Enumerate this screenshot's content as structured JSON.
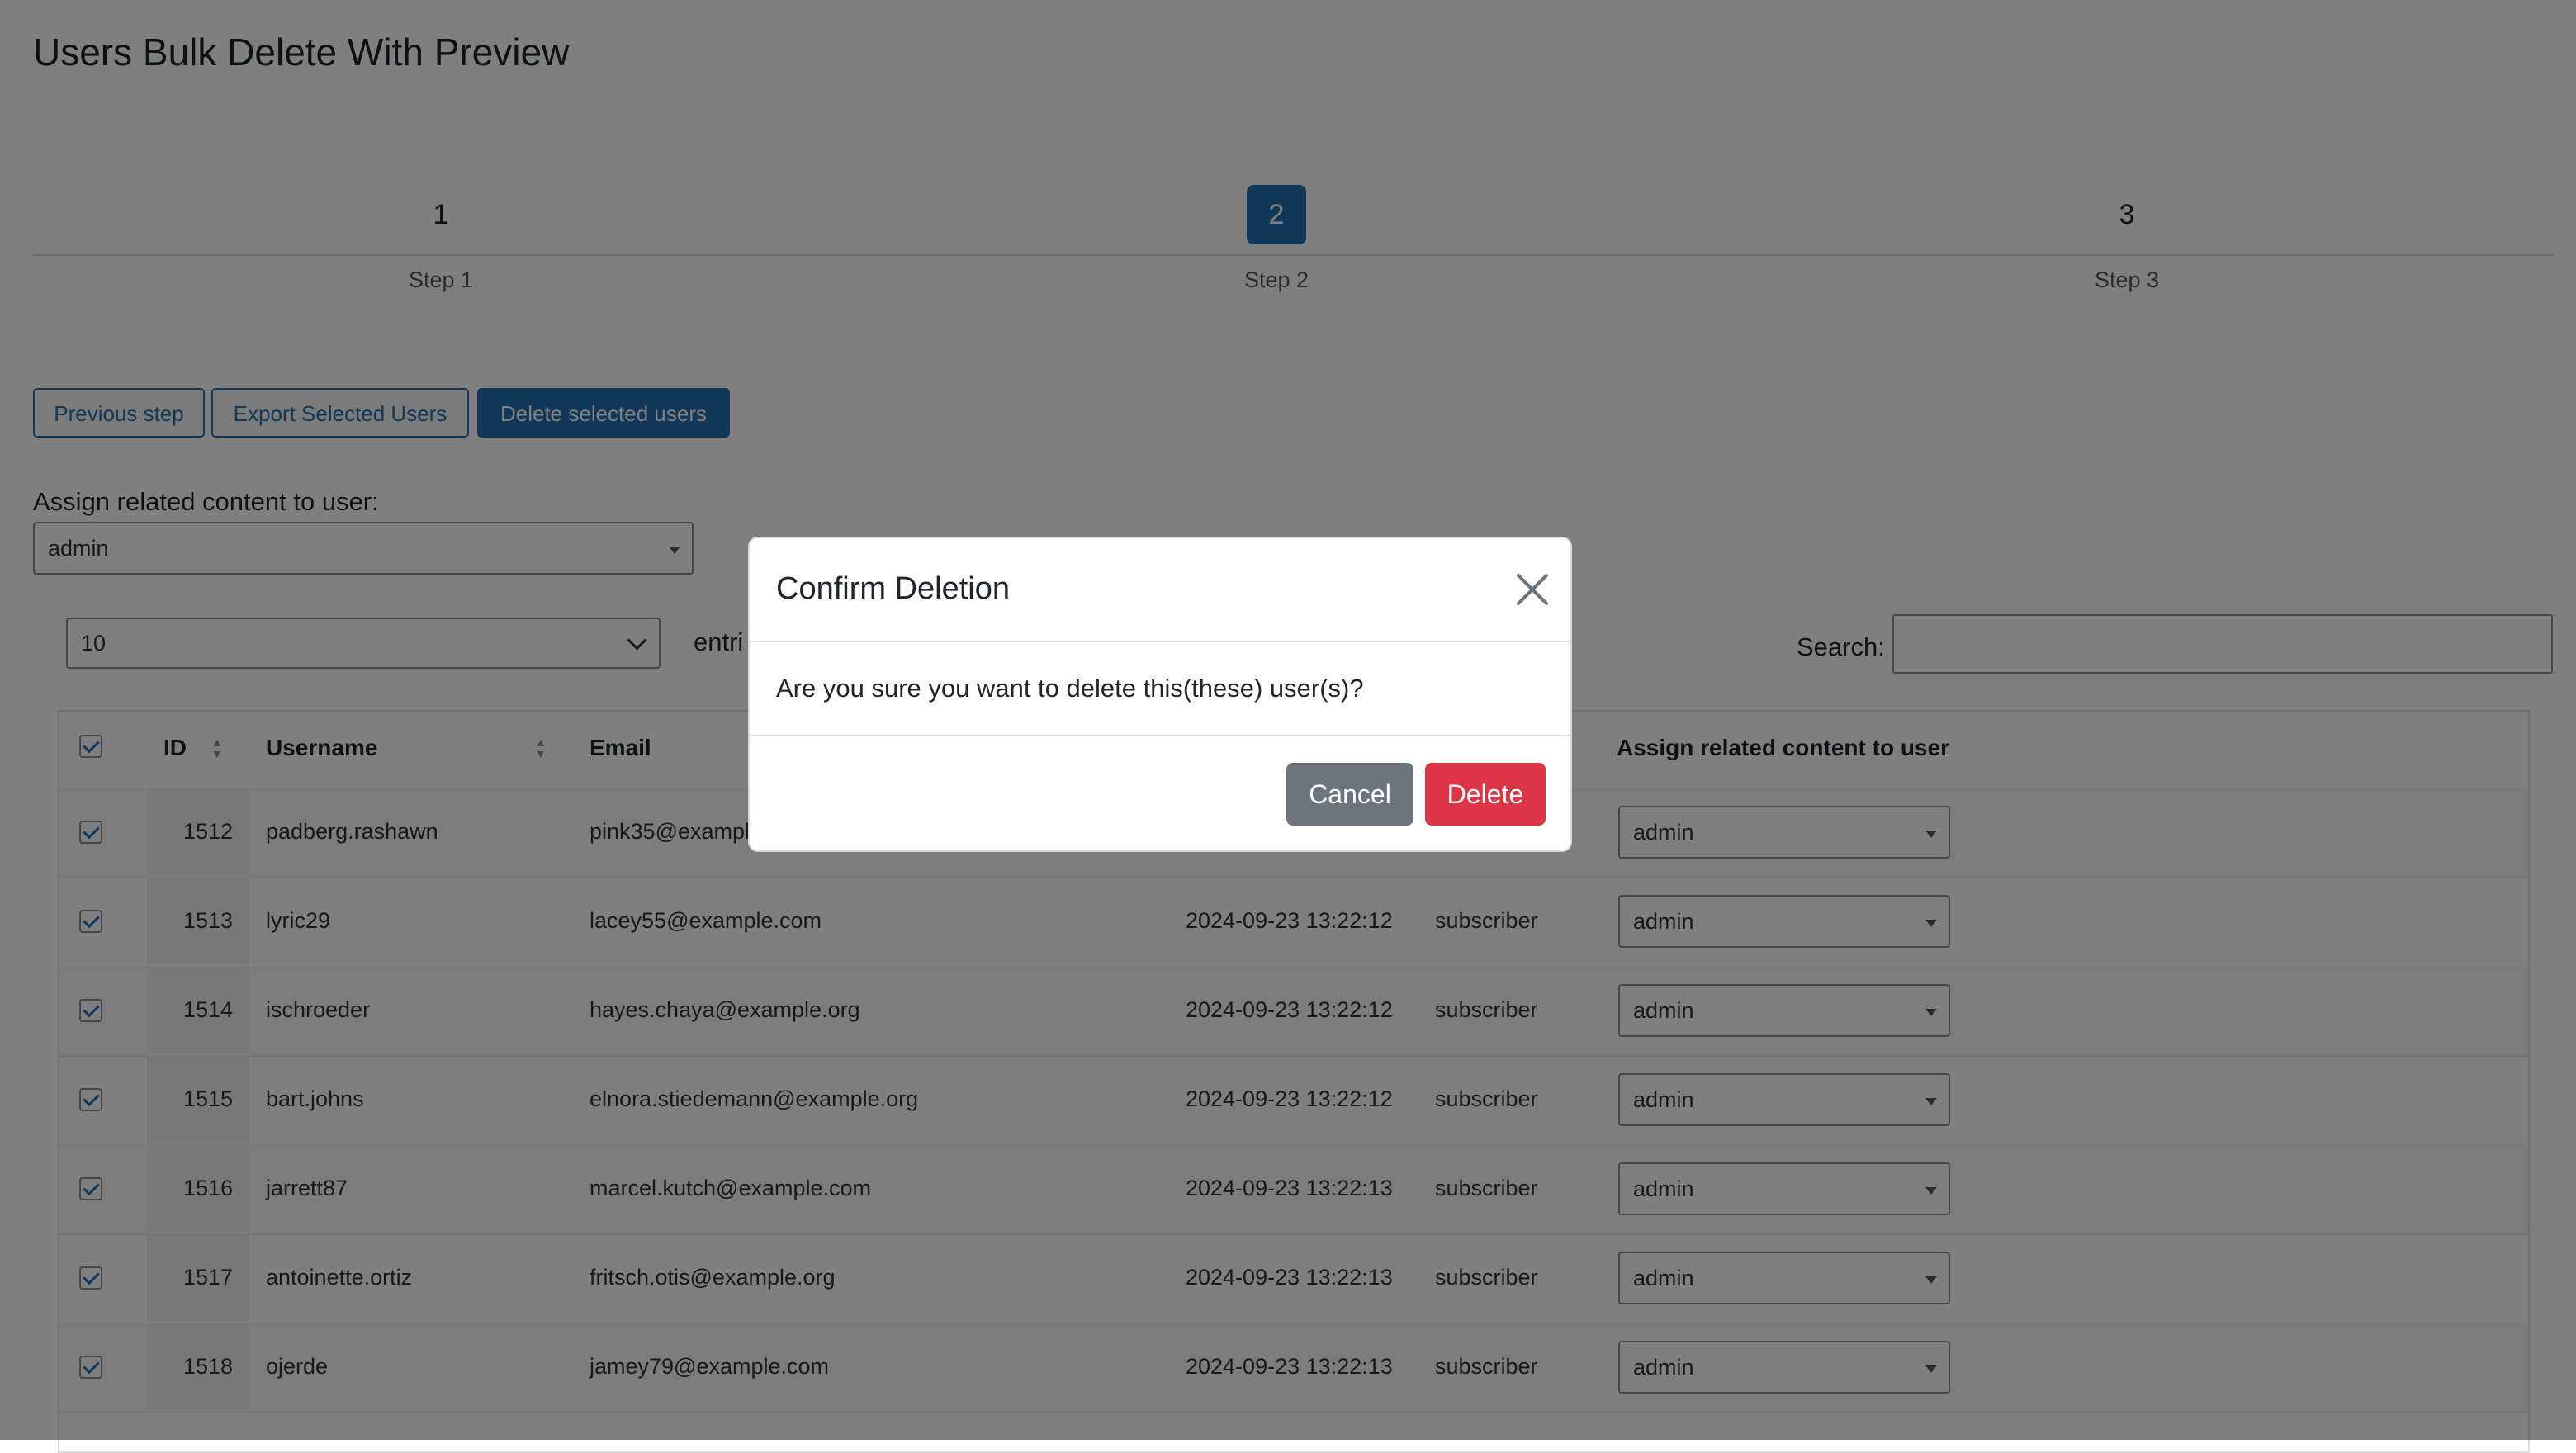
{
  "page": {
    "title": "Users Bulk Delete With Preview"
  },
  "steps": [
    {
      "number": "1",
      "label": "Step 1"
    },
    {
      "number": "2",
      "label": "Step 2",
      "active": true
    },
    {
      "number": "3",
      "label": "Step 3"
    }
  ],
  "actions": {
    "previous": "Previous step",
    "export": "Export Selected Users",
    "delete": "Delete selected users"
  },
  "assign": {
    "label": "Assign related content to user:",
    "value": "admin"
  },
  "table_controls": {
    "page_length": "10",
    "entries_label": "entri",
    "search_label": "Search:",
    "search_value": ""
  },
  "table": {
    "headers": {
      "id": "ID",
      "username": "Username",
      "email": "Email",
      "assign": "Assign related content to user"
    },
    "rows": [
      {
        "id": "1512",
        "username": "padberg.rashawn",
        "email": "pink35@exampl",
        "registered": "",
        "role": "",
        "assign": "admin",
        "checked": true
      },
      {
        "id": "1513",
        "username": "lyric29",
        "email": "lacey55@example.com",
        "registered": "2024-09-23 13:22:12",
        "role": "subscriber",
        "assign": "admin",
        "checked": true
      },
      {
        "id": "1514",
        "username": "ischroeder",
        "email": "hayes.chaya@example.org",
        "registered": "2024-09-23 13:22:12",
        "role": "subscriber",
        "assign": "admin",
        "checked": true
      },
      {
        "id": "1515",
        "username": "bart.johns",
        "email": "elnora.stiedemann@example.org",
        "registered": "2024-09-23 13:22:12",
        "role": "subscriber",
        "assign": "admin",
        "checked": true
      },
      {
        "id": "1516",
        "username": "jarrett87",
        "email": "marcel.kutch@example.com",
        "registered": "2024-09-23 13:22:13",
        "role": "subscriber",
        "assign": "admin",
        "checked": true
      },
      {
        "id": "1517",
        "username": "antoinette.ortiz",
        "email": "fritsch.otis@example.org",
        "registered": "2024-09-23 13:22:13",
        "role": "subscriber",
        "assign": "admin",
        "checked": true
      },
      {
        "id": "1518",
        "username": "ojerde",
        "email": "jamey79@example.com",
        "registered": "2024-09-23 13:22:13",
        "role": "subscriber",
        "assign": "admin",
        "checked": true
      }
    ]
  },
  "modal": {
    "title": "Confirm Deletion",
    "body": "Are you sure you want to delete this(these) user(s)?",
    "cancel": "Cancel",
    "delete": "Delete"
  },
  "colors": {
    "accent": "#2271b1",
    "danger": "#dc3545",
    "secondary": "#6c757d",
    "overlay": "rgba(0,0,0,0.5)"
  }
}
